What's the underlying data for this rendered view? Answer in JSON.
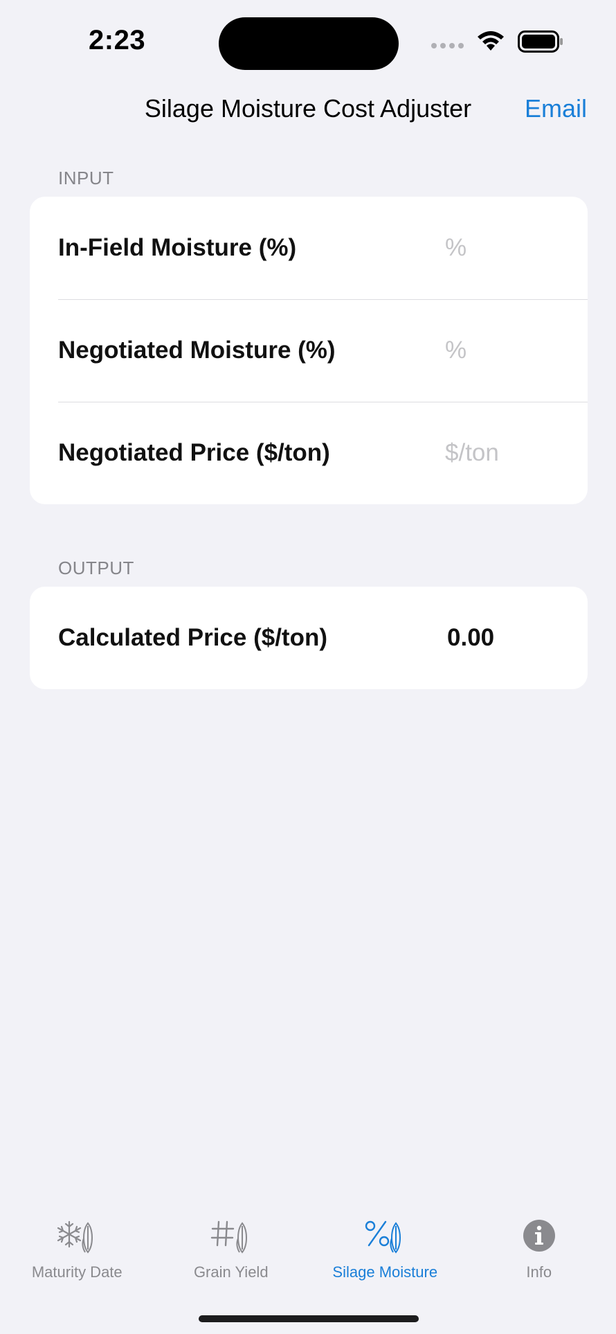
{
  "status_bar": {
    "time": "2:23"
  },
  "nav": {
    "title": "Silage Moisture Cost Adjuster",
    "email_label": "Email"
  },
  "input_section": {
    "header": "INPUT",
    "rows": [
      {
        "label": "In-Field Moisture (%)",
        "value": "",
        "placeholder": "%"
      },
      {
        "label": "Negotiated Moisture (%)",
        "value": "",
        "placeholder": "%"
      },
      {
        "label": "Negotiated Price ($/ton)",
        "value": "",
        "placeholder": "$/ton"
      }
    ]
  },
  "output_section": {
    "header": "OUTPUT",
    "rows": [
      {
        "label": "Calculated Price ($/ton)",
        "value": "0.00"
      }
    ]
  },
  "tabs": [
    {
      "label": "Maturity Date",
      "icon": "snowflake-corn-icon",
      "active": false
    },
    {
      "label": "Grain Yield",
      "icon": "hash-corn-icon",
      "active": false
    },
    {
      "label": "Silage Moisture",
      "icon": "percent-corn-icon",
      "active": true
    },
    {
      "label": "Info",
      "icon": "info-icon",
      "active": false
    }
  ],
  "colors": {
    "accent": "#1a7fd8",
    "background": "#f2f2f7",
    "inactive": "#8a8a8e"
  }
}
